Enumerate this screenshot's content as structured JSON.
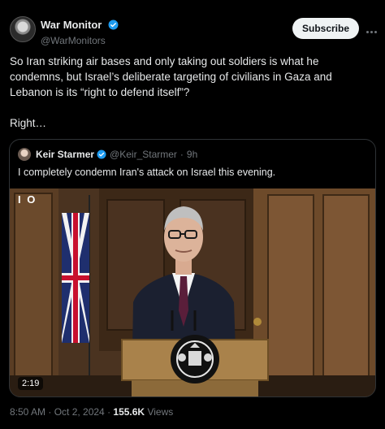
{
  "post": {
    "display_name": "War Monitor",
    "handle": "@WarMonitors",
    "subscribe_label": "Subscribe",
    "text_line1": "So Iran striking air bases and only taking out soldiers is what he",
    "text_line2": "condemns, but Israel’s deliberate targeting of civilians in Gaza and",
    "text_line3": "Lebanon is its “right to defend itself”?",
    "text_line4": "Right…",
    "timestamp": "8:50 AM · Oct 2, 2024 · ",
    "views_count": "155.6K",
    "views_label": " Views"
  },
  "quote": {
    "display_name": "Keir Starmer",
    "handle": "@Keir_Starmer",
    "separator": "·",
    "age": "9h",
    "text": "I completely condemn Iran's attack on Israel this evening.",
    "video": {
      "badge": "I O",
      "duration": "2:19"
    }
  },
  "icons": {
    "avatar": "war-monitor-avatar",
    "verified": "verified-badge-icon",
    "more": "more-options-icon"
  },
  "colors": {
    "background": "#000000",
    "text": "#e7e9ea",
    "muted": "#71767b",
    "verified": "#1d9bf0",
    "border": "#2f3336"
  }
}
